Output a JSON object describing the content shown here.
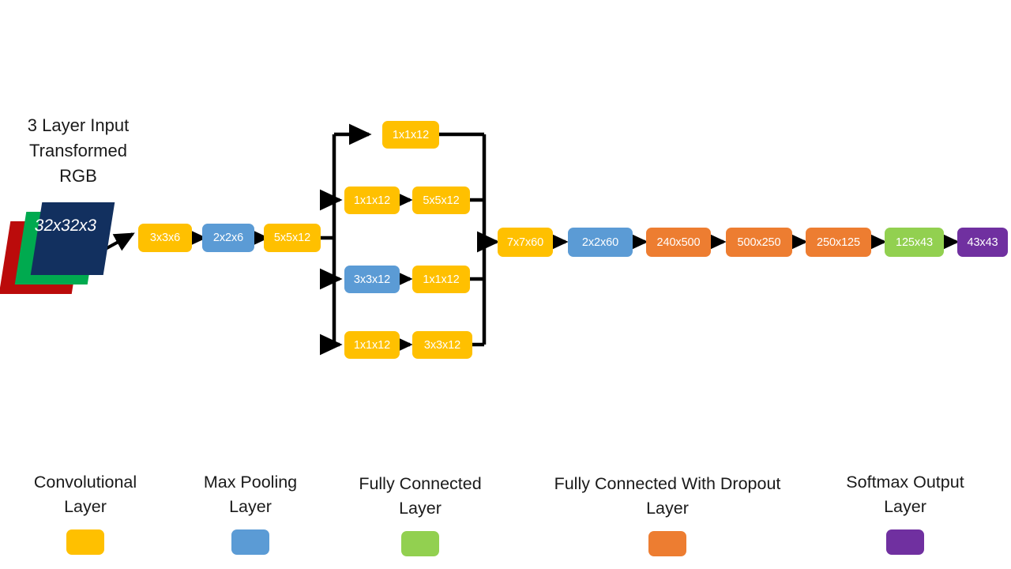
{
  "title": {
    "lines": [
      "3 Layer Input",
      "Transformed",
      "RGB"
    ],
    "text": "3 Layer Input Transformed RGB"
  },
  "input": {
    "label": "32x32x3",
    "sheet_colors": [
      "#BB0B0B",
      "#00AA4F",
      "#12305F"
    ]
  },
  "palette": {
    "conv": "#FFC000",
    "pool": "#5B9BD5",
    "fc": "#92D050",
    "dropout": "#ED7D31",
    "softmax": "#7030A0",
    "line": "#000000",
    "text_dark": "#1a1a1a"
  },
  "stem": [
    {
      "label": "3x3x6",
      "type": "conv"
    },
    {
      "label": "2x2x6",
      "type": "pool"
    },
    {
      "label": "5x5x12",
      "type": "conv"
    }
  ],
  "inception": {
    "branches": [
      {
        "nodes": [
          {
            "label": "1x1x12",
            "type": "conv"
          }
        ]
      },
      {
        "nodes": [
          {
            "label": "1x1x12",
            "type": "conv"
          },
          {
            "label": "5x5x12",
            "type": "conv"
          }
        ]
      },
      {
        "nodes": [
          {
            "label": "3x3x12",
            "type": "pool"
          },
          {
            "label": "1x1x12",
            "type": "conv"
          }
        ]
      },
      {
        "nodes": [
          {
            "label": "1x1x12",
            "type": "conv"
          },
          {
            "label": "3x3x12",
            "type": "conv"
          }
        ]
      }
    ]
  },
  "head": [
    {
      "label": "7x7x60",
      "type": "conv"
    },
    {
      "label": "2x2x60",
      "type": "pool"
    },
    {
      "label": "240x500",
      "type": "dropout"
    },
    {
      "label": "500x250",
      "type": "dropout"
    },
    {
      "label": "250x125",
      "type": "dropout"
    },
    {
      "label": "125x43",
      "type": "fc"
    },
    {
      "label": "43x43",
      "type": "softmax"
    }
  ],
  "legend": [
    {
      "lines": [
        "Convolutional",
        "Layer"
      ],
      "text": "Convolutional Layer",
      "swatch": "conv"
    },
    {
      "lines": [
        "Max Pooling",
        "Layer"
      ],
      "text": "Max Pooling Layer",
      "swatch": "pool"
    },
    {
      "lines": [
        "Fully Connected",
        "Layer"
      ],
      "text": "Fully Connected Layer",
      "swatch": "fc"
    },
    {
      "lines": [
        "Fully Connected With Dropout",
        "Layer"
      ],
      "text": "Fully Connected With Dropout Layer",
      "swatch": "dropout"
    },
    {
      "lines": [
        "Softmax Output",
        "Layer"
      ],
      "text": "Softmax Output Layer",
      "swatch": "softmax"
    }
  ]
}
